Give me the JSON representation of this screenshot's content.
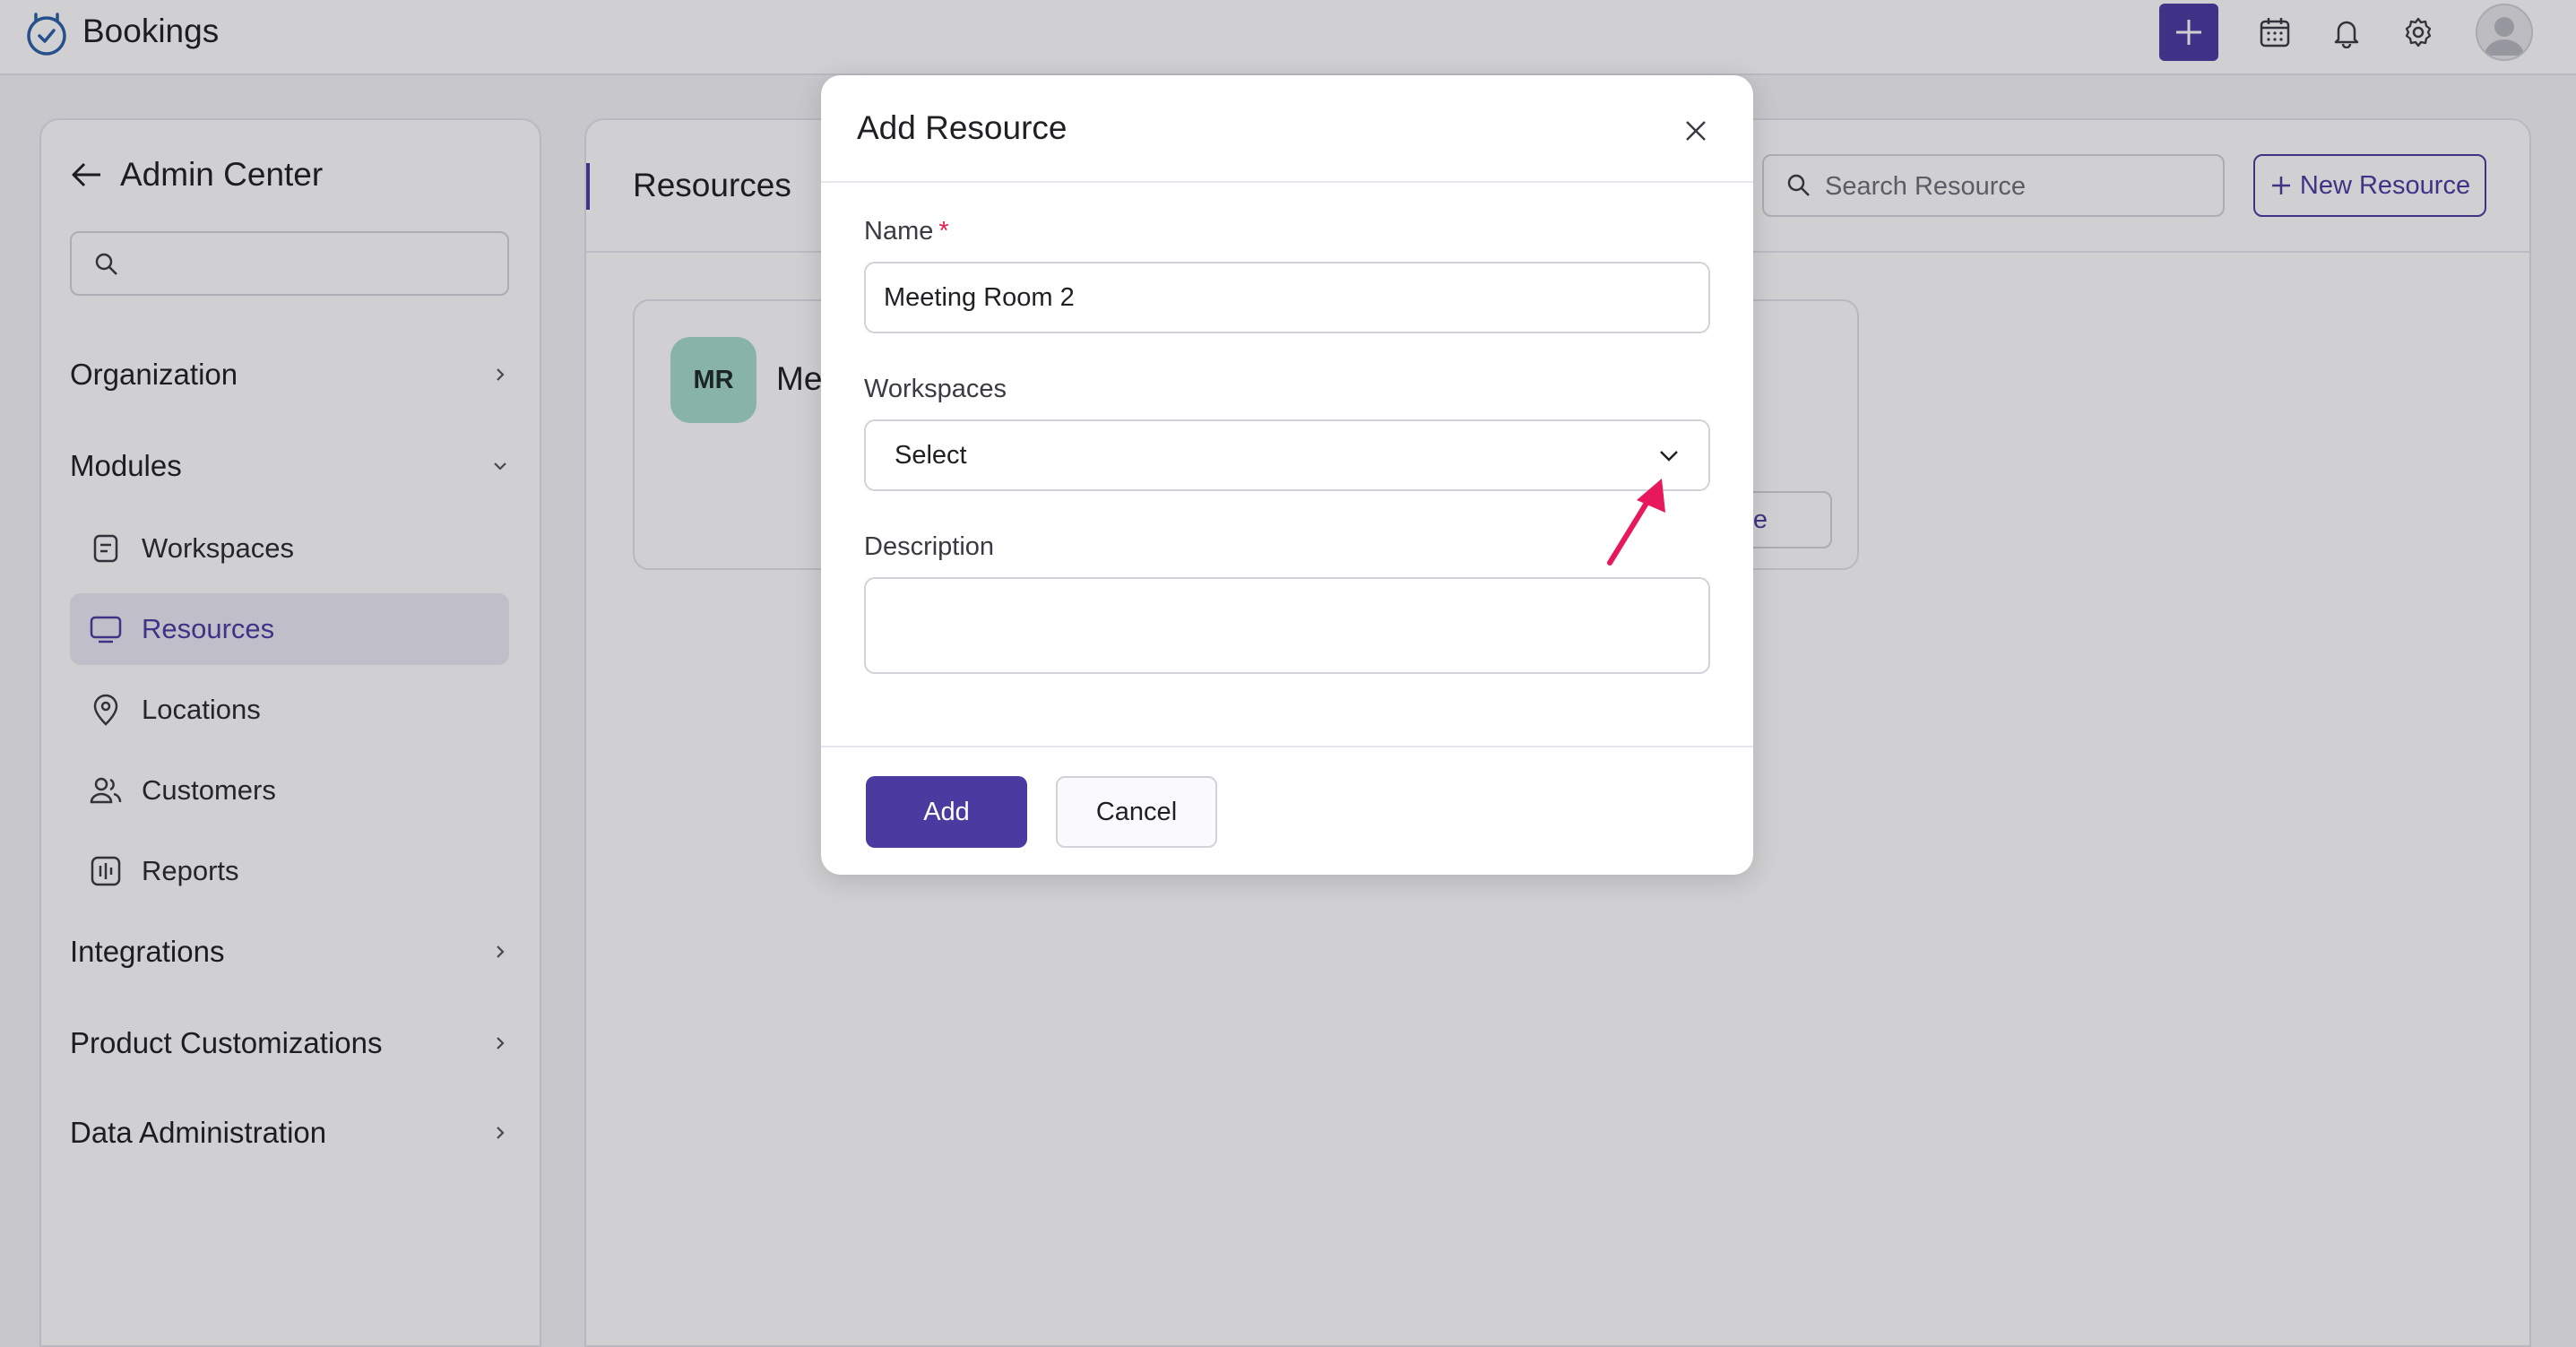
{
  "app": {
    "name": "Bookings"
  },
  "sidebar": {
    "title": "Admin Center",
    "search_placeholder": "",
    "sections": [
      {
        "label": "Organization",
        "expanded": false
      },
      {
        "label": "Modules",
        "expanded": true
      },
      {
        "label": "Integrations",
        "expanded": false
      },
      {
        "label": "Product Customizations",
        "expanded": false
      },
      {
        "label": "Data Administration",
        "expanded": false
      }
    ],
    "module_items": [
      {
        "label": "Workspaces",
        "icon": "document-icon",
        "active": false
      },
      {
        "label": "Resources",
        "icon": "monitor-icon",
        "active": true
      },
      {
        "label": "Locations",
        "icon": "location-pin-icon",
        "active": false
      },
      {
        "label": "Customers",
        "icon": "users-icon",
        "active": false
      },
      {
        "label": "Reports",
        "icon": "reports-icon",
        "active": false
      }
    ]
  },
  "main": {
    "title": "Resources",
    "search_placeholder": "Search Resource",
    "new_button": "New Resource",
    "card": {
      "initials": "MR",
      "name_partial": "Me",
      "share_partial": "are"
    }
  },
  "dialog": {
    "title": "Add Resource",
    "name_label": "Name",
    "name_required_mark": "*",
    "name_value": "Meeting Room 2",
    "workspaces_label": "Workspaces",
    "workspaces_value": "Select",
    "description_label": "Description",
    "description_value": "",
    "add_button": "Add",
    "cancel_button": "Cancel"
  },
  "colors": {
    "accent": "#4b3aa0",
    "avatar_bg": "#a5dccb",
    "annotation_arrow": "#e8185c",
    "required_mark": "#e02050"
  }
}
